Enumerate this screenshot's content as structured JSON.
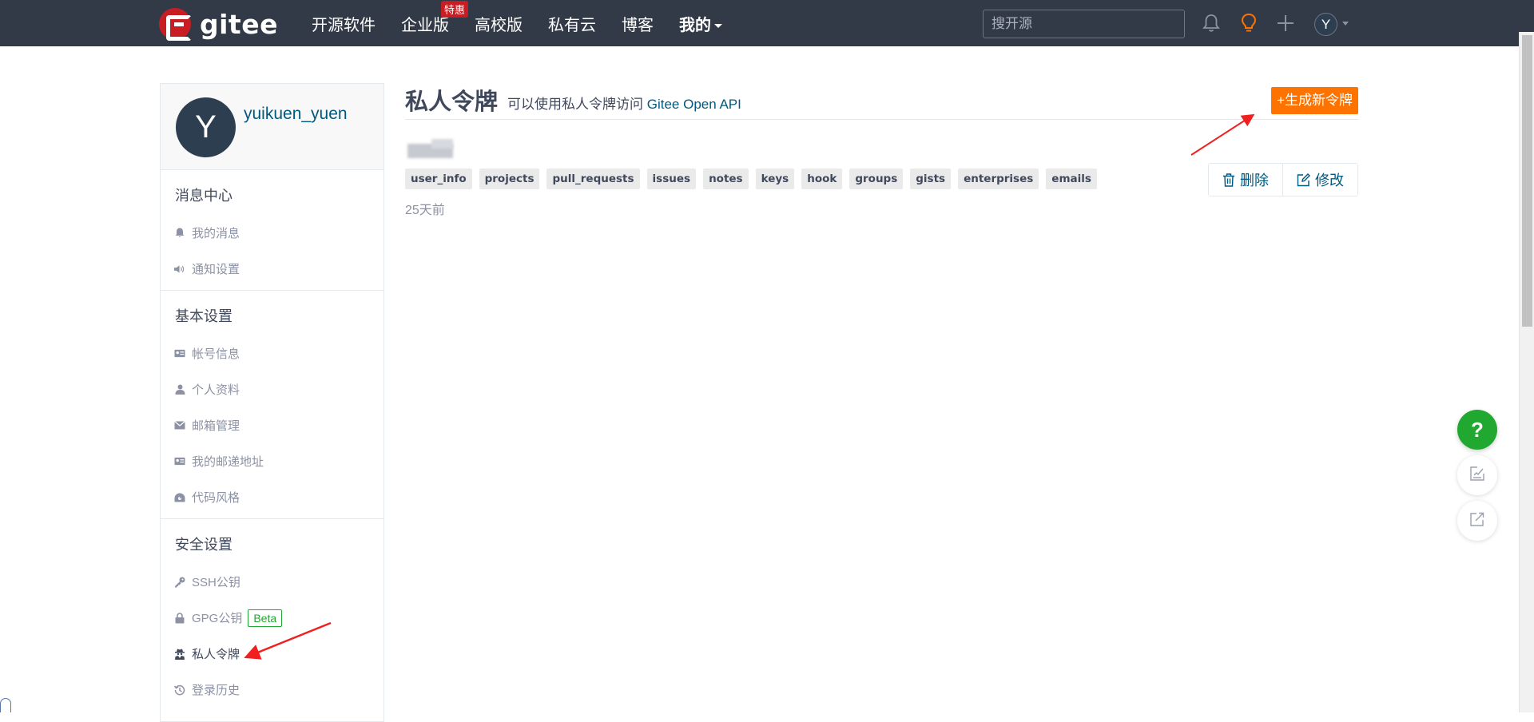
{
  "header": {
    "logo_text": "gitee",
    "nav": [
      {
        "label": "开源软件"
      },
      {
        "label": "企业版",
        "badge": "特惠"
      },
      {
        "label": "高校版"
      },
      {
        "label": "私有云"
      },
      {
        "label": "博客"
      },
      {
        "label": "我的"
      }
    ],
    "search_placeholder": "搜开源",
    "icons": [
      "bell-icon",
      "lightbulb-icon",
      "plus-icon"
    ],
    "avatar_initial": "Y",
    "brand_color": "#c71d23",
    "background": "#323a47"
  },
  "sidebar": {
    "username": "yuikuen_yuen",
    "avatar_initial": "Y",
    "sections": [
      {
        "title": "消息中心",
        "items": [
          {
            "label": "我的消息",
            "icon": "bell-icon"
          },
          {
            "label": "通知设置",
            "icon": "speaker-icon"
          }
        ]
      },
      {
        "title": "基本设置",
        "items": [
          {
            "label": "帐号信息",
            "icon": "id-card-icon"
          },
          {
            "label": "个人资料",
            "icon": "user-icon"
          },
          {
            "label": "邮箱管理",
            "icon": "envelope-icon"
          },
          {
            "label": "我的邮递地址",
            "icon": "address-card-icon"
          },
          {
            "label": "代码风格",
            "icon": "palette-icon"
          }
        ]
      },
      {
        "title": "安全设置",
        "items": [
          {
            "label": "SSH公钥",
            "icon": "key-icon"
          },
          {
            "label": "GPG公钥",
            "icon": "lock-icon",
            "badge": "Beta"
          },
          {
            "label": "私人令牌",
            "icon": "user-secret-icon",
            "active": true
          },
          {
            "label": "登录历史",
            "icon": "history-icon"
          }
        ]
      }
    ]
  },
  "main": {
    "title": "私人令牌",
    "subtitle_prefix": "可以使用私人令牌访问",
    "subtitle_link": "Gitee Open API",
    "generate_button": "+生成新令牌",
    "token": {
      "scopes": [
        "user_info",
        "projects",
        "pull_requests",
        "issues",
        "notes",
        "keys",
        "hook",
        "groups",
        "gists",
        "enterprises",
        "emails"
      ],
      "time": "25天前",
      "delete_label": "删除",
      "edit_label": "修改"
    }
  },
  "fabs": [
    {
      "label": "?",
      "icon": "help-icon"
    },
    {
      "icon": "feedback-icon"
    },
    {
      "icon": "share-icon"
    }
  ],
  "colors": {
    "accent_orange": "#fe7300",
    "link_blue": "#005980",
    "success_green": "#21a831",
    "annotation_red": "#f02020"
  }
}
